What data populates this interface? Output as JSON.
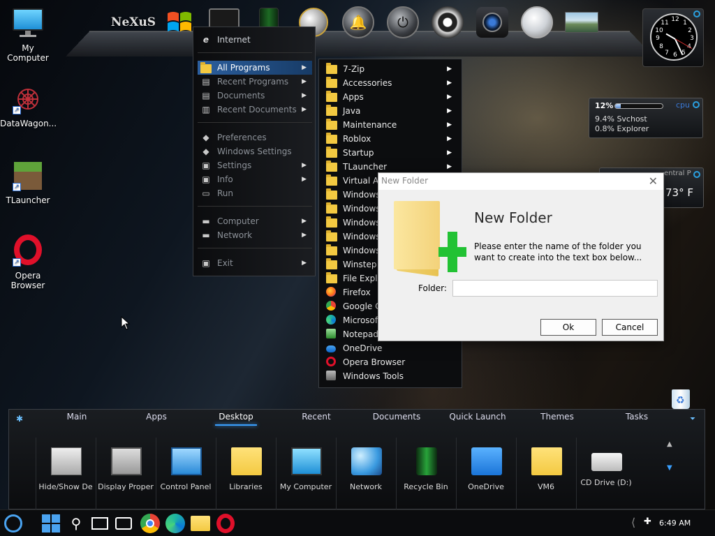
{
  "desktop_icons": [
    {
      "label": "My Computer"
    },
    {
      "label": "DataWagon..."
    },
    {
      "label": "TLauncher"
    },
    {
      "label": "Opera Browser"
    }
  ],
  "dock_logo": "NeXuS",
  "start_menu": {
    "internet": "Internet",
    "items": [
      {
        "label": "All Programs",
        "active": true,
        "arrow": true
      },
      {
        "label": "Recent Programs",
        "arrow": true
      },
      {
        "label": "Documents",
        "arrow": true
      },
      {
        "label": "Recent Documents",
        "arrow": true
      },
      {
        "label": "Preferences"
      },
      {
        "label": "Windows Settings"
      },
      {
        "label": "Settings",
        "arrow": true
      },
      {
        "label": "Info",
        "arrow": true
      },
      {
        "label": "Run"
      },
      {
        "label": "Computer",
        "arrow": true
      },
      {
        "label": "Network",
        "arrow": true
      },
      {
        "label": "Exit",
        "arrow": true
      }
    ]
  },
  "all_programs": [
    {
      "label": "7-Zip",
      "type": "folder",
      "arrow": true
    },
    {
      "label": "Accessories",
      "type": "folder",
      "arrow": true
    },
    {
      "label": "Apps",
      "type": "folder",
      "arrow": true
    },
    {
      "label": "Java",
      "type": "folder",
      "arrow": true
    },
    {
      "label": "Maintenance",
      "type": "folder",
      "arrow": true
    },
    {
      "label": "Roblox",
      "type": "folder",
      "arrow": true
    },
    {
      "label": "Startup",
      "type": "folder",
      "arrow": true
    },
    {
      "label": "TLauncher",
      "type": "folder",
      "arrow": true
    },
    {
      "label": "Virtual Au",
      "type": "folder"
    },
    {
      "label": "Windows",
      "type": "folder"
    },
    {
      "label": "Windows",
      "type": "folder"
    },
    {
      "label": "Windows",
      "type": "folder"
    },
    {
      "label": "Windows",
      "type": "folder"
    },
    {
      "label": "Windows",
      "type": "folder"
    },
    {
      "label": "Winstep",
      "type": "folder"
    },
    {
      "label": "File Explor",
      "type": "folder"
    },
    {
      "label": "Firefox",
      "type": "firefox"
    },
    {
      "label": "Google Ch",
      "type": "chrome"
    },
    {
      "label": "Microsoft",
      "type": "edge"
    },
    {
      "label": "Notepad+",
      "type": "notepad"
    },
    {
      "label": "OneDrive",
      "type": "onedrive"
    },
    {
      "label": "Opera Browser",
      "type": "opera"
    },
    {
      "label": "Windows Tools",
      "type": "tools"
    }
  ],
  "dialog": {
    "title": "New Folder",
    "heading": "New Folder",
    "message": "Please enter the name of the folder you want to create into the text box below...",
    "folder_label": "Folder:",
    "folder_value": "",
    "ok_label": "Ok",
    "cancel_label": "Cancel"
  },
  "cpu_gadget": {
    "percent_label": "12%",
    "percent_value": 12,
    "title": "cpu",
    "proc1": "9.4% Svchost",
    "proc2": "0.8% Explorer"
  },
  "weather_gadget": {
    "location": "entral P",
    "temp": "73° F"
  },
  "clock_numbers": [
    "12",
    "1",
    "2",
    "3",
    "4",
    "5",
    "6",
    "7",
    "8",
    "9",
    "10",
    "11"
  ],
  "panel": {
    "tabs": [
      "Main",
      "Apps",
      "Desktop",
      "Recent",
      "Documents",
      "Quick Launch",
      "Themes",
      "Tasks"
    ],
    "active_tab": "Desktop",
    "tiles": [
      {
        "label": "Hide/Show De"
      },
      {
        "label": "Display Proper"
      },
      {
        "label": "Control Panel"
      },
      {
        "label": "Libraries"
      },
      {
        "label": "My Computer"
      },
      {
        "label": "Network"
      },
      {
        "label": "Recycle Bin"
      },
      {
        "label": "OneDrive"
      },
      {
        "label": "VM6"
      },
      {
        "label": "CD Drive (D:)"
      }
    ]
  },
  "taskbar": {
    "time": "6:49 AM"
  }
}
